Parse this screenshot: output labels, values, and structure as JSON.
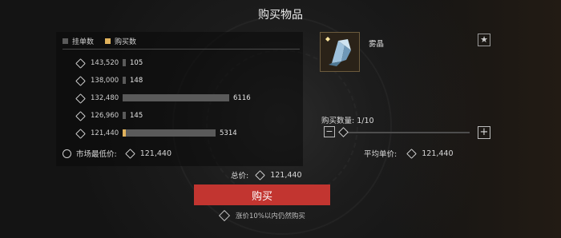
{
  "title": "购买物品",
  "legend": {
    "listings_label": "挂单数",
    "purchase_label": "购买数"
  },
  "colors": {
    "listings": "#5a5a5a",
    "purchase": "#e0b25c",
    "buy_button": "#c23530"
  },
  "orders": [
    {
      "price": "143,520",
      "count": "105",
      "fill": 0.02,
      "type": "gray"
    },
    {
      "price": "138,000",
      "count": "148",
      "fill": 0.02,
      "type": "gray"
    },
    {
      "price": "132,480",
      "count": "6116",
      "fill": 0.7,
      "type": "gray"
    },
    {
      "price": "126,960",
      "count": "145",
      "fill": 0.02,
      "type": "gray"
    },
    {
      "price": "121,440",
      "count": "5314",
      "fill": 0.61,
      "type": "gray",
      "purchase_fill": 0.02
    }
  ],
  "lowest": {
    "label": "市场最低价:",
    "value": "121,440"
  },
  "item": {
    "name": "雾晶",
    "icon": "crystal-icon",
    "favorite_icon": "star-icon"
  },
  "quantity": {
    "label": "购买数量:",
    "value": "1/10",
    "fraction": 0.1
  },
  "average": {
    "label": "平均单价:",
    "value": "121,440"
  },
  "total": {
    "label": "总价:",
    "value": "121,440"
  },
  "buy_button": "购买",
  "warning": "涨价10%以内仍然购买"
}
